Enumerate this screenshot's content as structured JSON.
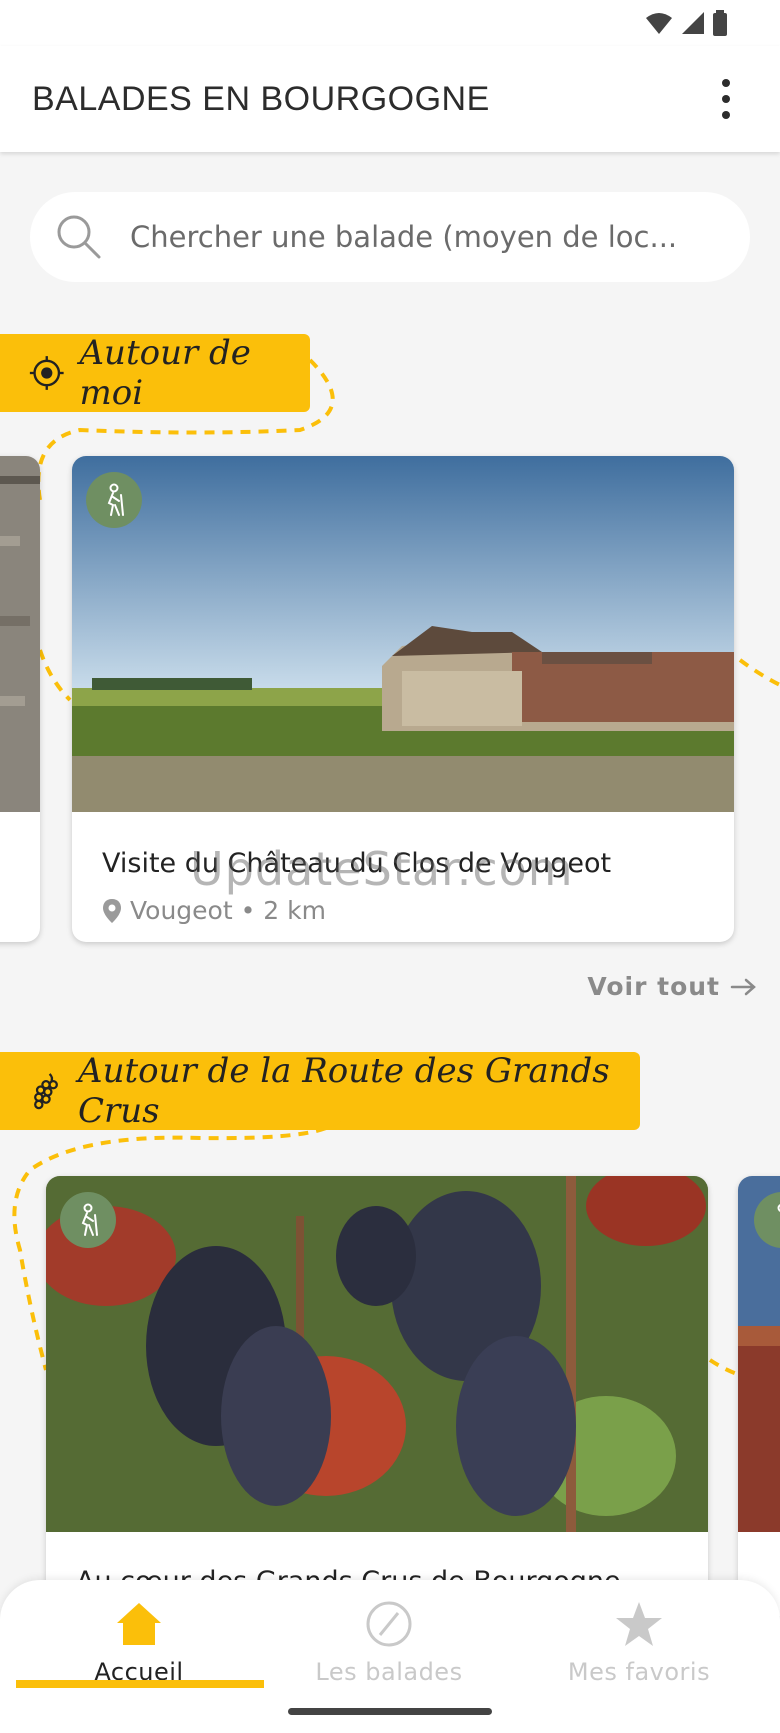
{
  "app": {
    "title": "BALADES EN BOURGOGNE"
  },
  "search": {
    "placeholder": "Chercher une balade (moyen de loc..."
  },
  "sections": [
    {
      "title": "Autour de moi",
      "icon": "target-icon",
      "cards": [
        {
          "title": "Visite du Château du Clos de Vougeot",
          "location": "Vougeot",
          "distance": "2 km",
          "meta": "Vougeot • 2 km"
        }
      ],
      "see_all": "Voir tout"
    },
    {
      "title": "Autour de la Route des Grands Crus",
      "icon": "grapes-icon",
      "cards": [
        {
          "title": "Au cœur des Grands Crus de Bourgogne"
        }
      ]
    }
  ],
  "watermark": "UpdateStar.com",
  "bottom_nav": {
    "items": [
      {
        "label": "Accueil",
        "icon": "home-icon",
        "active": true
      },
      {
        "label": "Les balades",
        "icon": "compass-icon",
        "active": false
      },
      {
        "label": "Mes favoris",
        "icon": "star-icon",
        "active": false
      }
    ]
  },
  "colors": {
    "accent": "#fbbf0a",
    "badge": "#6f8f62",
    "muted": "#8a8a8a"
  }
}
